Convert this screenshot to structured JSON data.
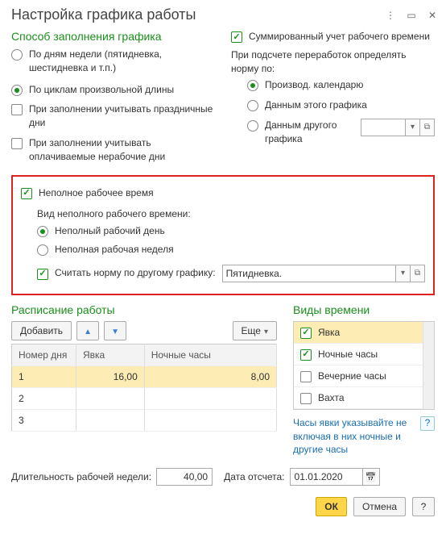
{
  "title": "Настройка графика работы",
  "fill_method": {
    "title": "Способ заполнения графика",
    "by_days": "По дням недели (пятидневка, шестидневка и т.п.)",
    "by_cycles": "По циклам произвольной длины",
    "holidays": "При заполнении учитывать праздничные дни",
    "paid_off": "При заполнении учитывать оплачиваемые нерабочие дни"
  },
  "right": {
    "summed": "Суммированный учет рабочего времени",
    "overtime_label": "При подсчете переработок определять норму по:",
    "r1": "Производ. календарю",
    "r2": "Данным этого графика",
    "r3": "Данным другого графика"
  },
  "partial": {
    "chk": "Неполное рабочее время",
    "kind_label": "Вид неполного рабочего времени:",
    "day": "Неполный рабочий день",
    "week": "Неполная рабочая неделя",
    "other_norm": "Считать норму по другому графику:",
    "other_value": "Пятидневка."
  },
  "schedule": {
    "title": "Расписание работы",
    "add": "Добавить",
    "more": "Еще",
    "cols": {
      "num": "Номер дня",
      "att": "Явка",
      "night": "Ночные часы"
    },
    "rows": [
      {
        "num": "1",
        "att": "16,00",
        "night": "8,00"
      },
      {
        "num": "2",
        "att": "",
        "night": ""
      },
      {
        "num": "3",
        "att": "",
        "night": ""
      }
    ]
  },
  "types": {
    "title": "Виды времени",
    "items": [
      {
        "label": "Явка",
        "checked": true,
        "sel": true
      },
      {
        "label": "Ночные часы",
        "checked": true
      },
      {
        "label": "Вечерние часы",
        "checked": false
      },
      {
        "label": "Вахта",
        "checked": false
      }
    ],
    "hint": "Часы явки указывайте не включая в них ночные и другие часы"
  },
  "bottom": {
    "week_len_label": "Длительность рабочей недели:",
    "week_len": "40,00",
    "date_label": "Дата отсчета:",
    "date": "01.01.2020"
  },
  "footer": {
    "ok": "ОК",
    "cancel": "Отмена"
  }
}
